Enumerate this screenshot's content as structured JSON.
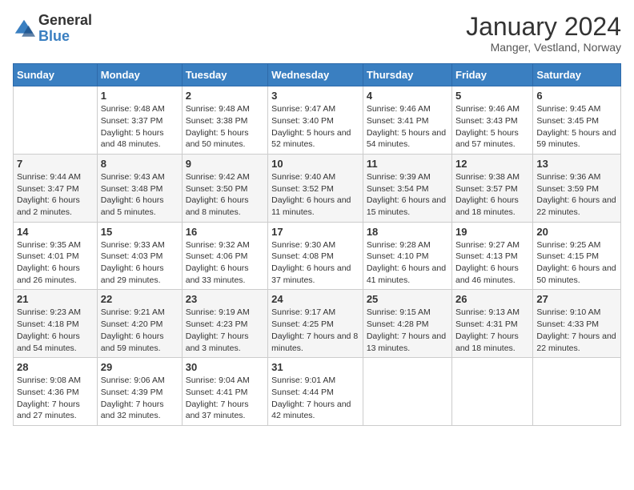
{
  "logo": {
    "text_general": "General",
    "text_blue": "Blue"
  },
  "title": "January 2024",
  "subtitle": "Manger, Vestland, Norway",
  "days_of_week": [
    "Sunday",
    "Monday",
    "Tuesday",
    "Wednesday",
    "Thursday",
    "Friday",
    "Saturday"
  ],
  "weeks": [
    [
      {
        "day": "",
        "sunrise": "",
        "sunset": "",
        "daylight": ""
      },
      {
        "day": "1",
        "sunrise": "Sunrise: 9:48 AM",
        "sunset": "Sunset: 3:37 PM",
        "daylight": "Daylight: 5 hours and 48 minutes."
      },
      {
        "day": "2",
        "sunrise": "Sunrise: 9:48 AM",
        "sunset": "Sunset: 3:38 PM",
        "daylight": "Daylight: 5 hours and 50 minutes."
      },
      {
        "day": "3",
        "sunrise": "Sunrise: 9:47 AM",
        "sunset": "Sunset: 3:40 PM",
        "daylight": "Daylight: 5 hours and 52 minutes."
      },
      {
        "day": "4",
        "sunrise": "Sunrise: 9:46 AM",
        "sunset": "Sunset: 3:41 PM",
        "daylight": "Daylight: 5 hours and 54 minutes."
      },
      {
        "day": "5",
        "sunrise": "Sunrise: 9:46 AM",
        "sunset": "Sunset: 3:43 PM",
        "daylight": "Daylight: 5 hours and 57 minutes."
      },
      {
        "day": "6",
        "sunrise": "Sunrise: 9:45 AM",
        "sunset": "Sunset: 3:45 PM",
        "daylight": "Daylight: 5 hours and 59 minutes."
      }
    ],
    [
      {
        "day": "7",
        "sunrise": "Sunrise: 9:44 AM",
        "sunset": "Sunset: 3:47 PM",
        "daylight": "Daylight: 6 hours and 2 minutes."
      },
      {
        "day": "8",
        "sunrise": "Sunrise: 9:43 AM",
        "sunset": "Sunset: 3:48 PM",
        "daylight": "Daylight: 6 hours and 5 minutes."
      },
      {
        "day": "9",
        "sunrise": "Sunrise: 9:42 AM",
        "sunset": "Sunset: 3:50 PM",
        "daylight": "Daylight: 6 hours and 8 minutes."
      },
      {
        "day": "10",
        "sunrise": "Sunrise: 9:40 AM",
        "sunset": "Sunset: 3:52 PM",
        "daylight": "Daylight: 6 hours and 11 minutes."
      },
      {
        "day": "11",
        "sunrise": "Sunrise: 9:39 AM",
        "sunset": "Sunset: 3:54 PM",
        "daylight": "Daylight: 6 hours and 15 minutes."
      },
      {
        "day": "12",
        "sunrise": "Sunrise: 9:38 AM",
        "sunset": "Sunset: 3:57 PM",
        "daylight": "Daylight: 6 hours and 18 minutes."
      },
      {
        "day": "13",
        "sunrise": "Sunrise: 9:36 AM",
        "sunset": "Sunset: 3:59 PM",
        "daylight": "Daylight: 6 hours and 22 minutes."
      }
    ],
    [
      {
        "day": "14",
        "sunrise": "Sunrise: 9:35 AM",
        "sunset": "Sunset: 4:01 PM",
        "daylight": "Daylight: 6 hours and 26 minutes."
      },
      {
        "day": "15",
        "sunrise": "Sunrise: 9:33 AM",
        "sunset": "Sunset: 4:03 PM",
        "daylight": "Daylight: 6 hours and 29 minutes."
      },
      {
        "day": "16",
        "sunrise": "Sunrise: 9:32 AM",
        "sunset": "Sunset: 4:06 PM",
        "daylight": "Daylight: 6 hours and 33 minutes."
      },
      {
        "day": "17",
        "sunrise": "Sunrise: 9:30 AM",
        "sunset": "Sunset: 4:08 PM",
        "daylight": "Daylight: 6 hours and 37 minutes."
      },
      {
        "day": "18",
        "sunrise": "Sunrise: 9:28 AM",
        "sunset": "Sunset: 4:10 PM",
        "daylight": "Daylight: 6 hours and 41 minutes."
      },
      {
        "day": "19",
        "sunrise": "Sunrise: 9:27 AM",
        "sunset": "Sunset: 4:13 PM",
        "daylight": "Daylight: 6 hours and 46 minutes."
      },
      {
        "day": "20",
        "sunrise": "Sunrise: 9:25 AM",
        "sunset": "Sunset: 4:15 PM",
        "daylight": "Daylight: 6 hours and 50 minutes."
      }
    ],
    [
      {
        "day": "21",
        "sunrise": "Sunrise: 9:23 AM",
        "sunset": "Sunset: 4:18 PM",
        "daylight": "Daylight: 6 hours and 54 minutes."
      },
      {
        "day": "22",
        "sunrise": "Sunrise: 9:21 AM",
        "sunset": "Sunset: 4:20 PM",
        "daylight": "Daylight: 6 hours and 59 minutes."
      },
      {
        "day": "23",
        "sunrise": "Sunrise: 9:19 AM",
        "sunset": "Sunset: 4:23 PM",
        "daylight": "Daylight: 7 hours and 3 minutes."
      },
      {
        "day": "24",
        "sunrise": "Sunrise: 9:17 AM",
        "sunset": "Sunset: 4:25 PM",
        "daylight": "Daylight: 7 hours and 8 minutes."
      },
      {
        "day": "25",
        "sunrise": "Sunrise: 9:15 AM",
        "sunset": "Sunset: 4:28 PM",
        "daylight": "Daylight: 7 hours and 13 minutes."
      },
      {
        "day": "26",
        "sunrise": "Sunrise: 9:13 AM",
        "sunset": "Sunset: 4:31 PM",
        "daylight": "Daylight: 7 hours and 18 minutes."
      },
      {
        "day": "27",
        "sunrise": "Sunrise: 9:10 AM",
        "sunset": "Sunset: 4:33 PM",
        "daylight": "Daylight: 7 hours and 22 minutes."
      }
    ],
    [
      {
        "day": "28",
        "sunrise": "Sunrise: 9:08 AM",
        "sunset": "Sunset: 4:36 PM",
        "daylight": "Daylight: 7 hours and 27 minutes."
      },
      {
        "day": "29",
        "sunrise": "Sunrise: 9:06 AM",
        "sunset": "Sunset: 4:39 PM",
        "daylight": "Daylight: 7 hours and 32 minutes."
      },
      {
        "day": "30",
        "sunrise": "Sunrise: 9:04 AM",
        "sunset": "Sunset: 4:41 PM",
        "daylight": "Daylight: 7 hours and 37 minutes."
      },
      {
        "day": "31",
        "sunrise": "Sunrise: 9:01 AM",
        "sunset": "Sunset: 4:44 PM",
        "daylight": "Daylight: 7 hours and 42 minutes."
      },
      {
        "day": "",
        "sunrise": "",
        "sunset": "",
        "daylight": ""
      },
      {
        "day": "",
        "sunrise": "",
        "sunset": "",
        "daylight": ""
      },
      {
        "day": "",
        "sunrise": "",
        "sunset": "",
        "daylight": ""
      }
    ]
  ]
}
